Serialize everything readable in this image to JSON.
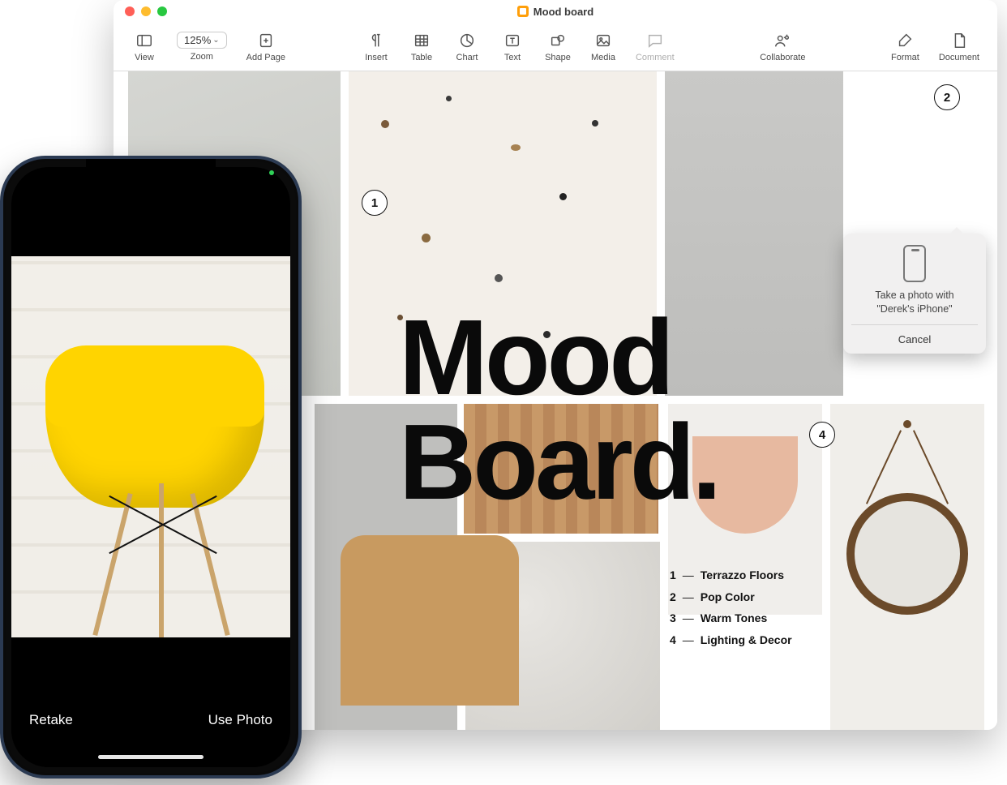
{
  "window": {
    "title": "Mood board"
  },
  "toolbar": {
    "view": "View",
    "zoom_value": "125%",
    "zoom_label": "Zoom",
    "add_page": "Add Page",
    "insert": "Insert",
    "table": "Table",
    "chart": "Chart",
    "text": "Text",
    "shape": "Shape",
    "media": "Media",
    "comment": "Comment",
    "collaborate": "Collaborate",
    "format": "Format",
    "document": "Document"
  },
  "document": {
    "heading_line1": "Mood",
    "heading_line2": "Board.",
    "callouts": {
      "c1": "1",
      "c2": "2",
      "c4": "4"
    },
    "legend": [
      {
        "n": "1",
        "label": "Terrazzo Floors"
      },
      {
        "n": "2",
        "label": "Pop Color"
      },
      {
        "n": "3",
        "label": "Warm Tones"
      },
      {
        "n": "4",
        "label": "Lighting & Decor"
      }
    ]
  },
  "popover": {
    "message_line1": "Take a photo with",
    "message_line2": "\"Derek's iPhone\"",
    "cancel": "Cancel"
  },
  "phone": {
    "retake": "Retake",
    "use_photo": "Use Photo"
  }
}
